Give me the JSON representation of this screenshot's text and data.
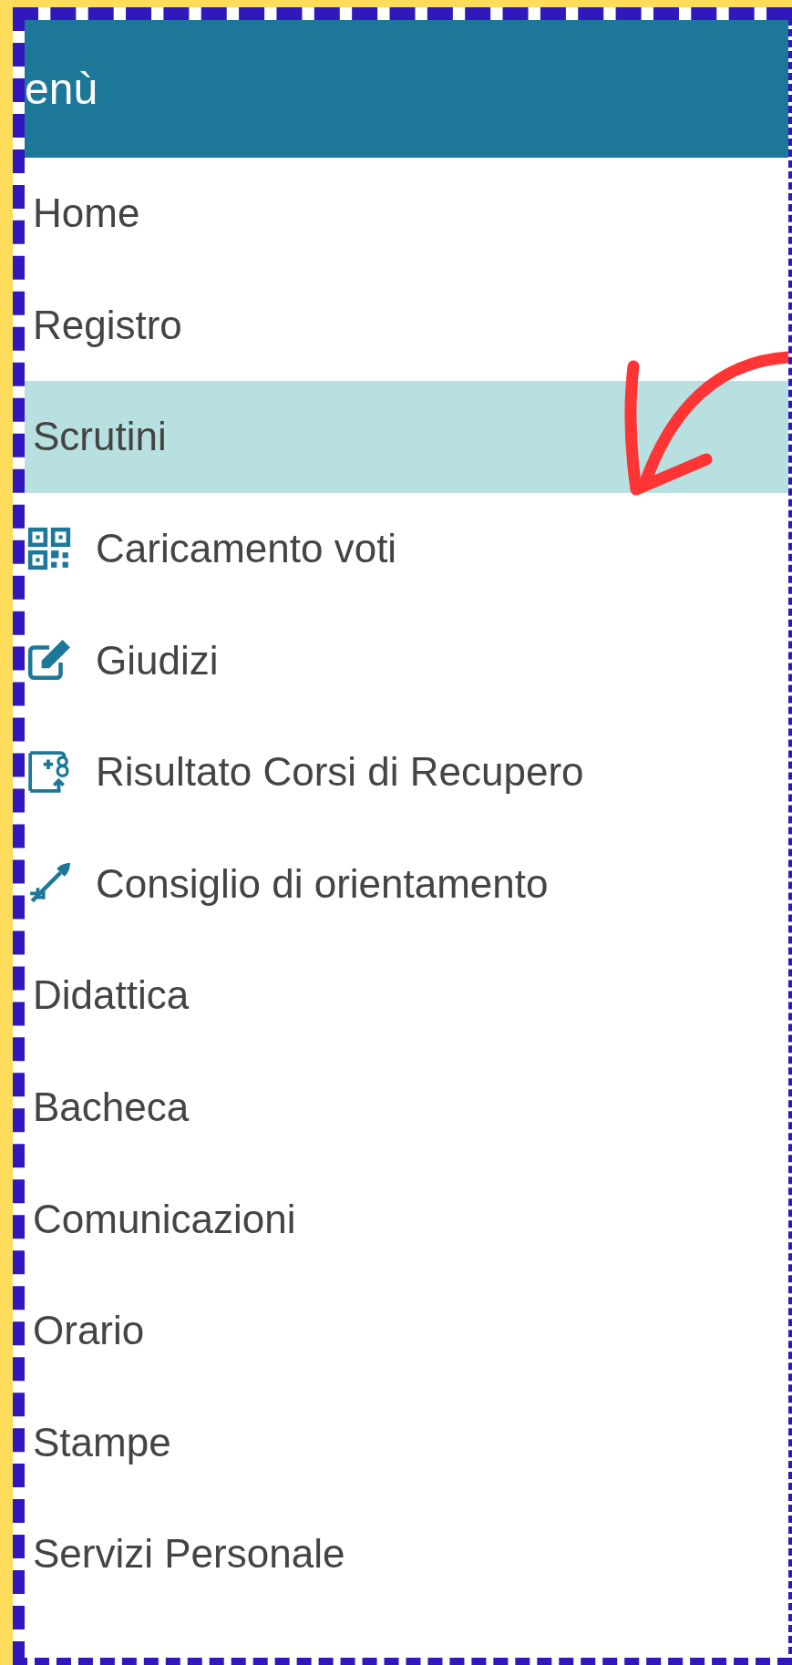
{
  "header": {
    "title": "enù"
  },
  "menu": [
    {
      "label": "Home",
      "selected": false
    },
    {
      "label": "Registro",
      "selected": false
    },
    {
      "label": "Scrutini",
      "selected": true,
      "children": [
        {
          "label": "Caricamento voti",
          "selected": false
        },
        {
          "label": "Giudizi",
          "selected": false
        },
        {
          "label": "Risultato Corsi di Recupero",
          "selected": false
        },
        {
          "label": "Consiglio di orientamento",
          "selected": false
        }
      ]
    },
    {
      "label": "Didattica",
      "selected": false
    },
    {
      "label": "Bacheca",
      "selected": false
    },
    {
      "label": "Comunicazioni",
      "selected": false
    },
    {
      "label": "Orario",
      "selected": false
    },
    {
      "label": "Stampe",
      "selected": false
    },
    {
      "label": "Servizi Personale",
      "selected": false
    }
  ]
}
